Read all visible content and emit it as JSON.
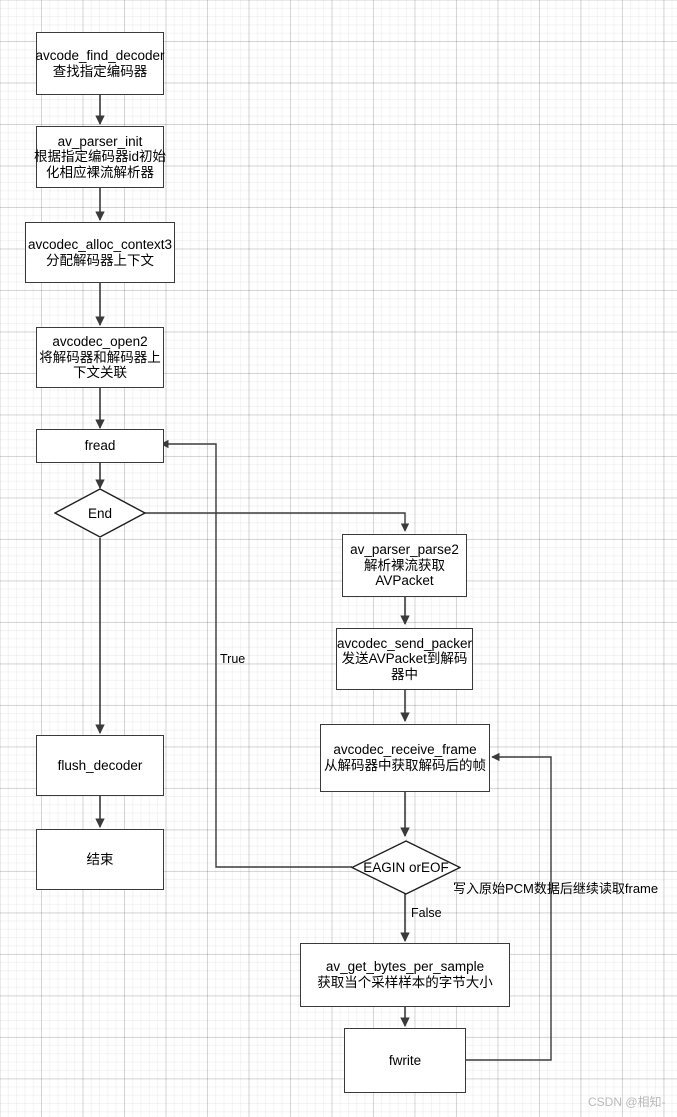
{
  "diagram": {
    "title": "FFmpeg audio decoding flowchart",
    "background": "#ffffff",
    "grid_color": "#e8e8e8",
    "node_border_color": "#3a3a3a",
    "edge_color": "#3a3a3a",
    "nodes": [
      {
        "id": "avcode_find_decoder",
        "shape": "process",
        "line1": "avcode_find_decoder",
        "line2": "查找指定编码器"
      },
      {
        "id": "av_parser_init",
        "shape": "process",
        "line1": "av_parser_init",
        "line2": "根据指定编码器id初始",
        "line3": "化相应裸流解析器"
      },
      {
        "id": "avcodec_alloc_context3",
        "shape": "process",
        "line1": "avcodec_alloc_context3",
        "line2": "分配解码器上下文"
      },
      {
        "id": "avcodec_open2",
        "shape": "process",
        "line1": "avcodec_open2",
        "line2": "将解码器和解码器上",
        "line3": "下文关联"
      },
      {
        "id": "fread",
        "shape": "process",
        "line1": "fread"
      },
      {
        "id": "end_decision",
        "shape": "decision",
        "line1": "End"
      },
      {
        "id": "flush_decoder",
        "shape": "process",
        "line1": "flush_decoder"
      },
      {
        "id": "finish",
        "shape": "process",
        "line1": "结束"
      },
      {
        "id": "av_parser_parse2",
        "shape": "process",
        "line1": "av_parser_parse2",
        "line2": "解析裸流获取",
        "line3": "AVPacket"
      },
      {
        "id": "avcodec_send_packer",
        "shape": "process",
        "line1": "avcodec_send_packer",
        "line2": "发送AVPacket到解码",
        "line3": "器中"
      },
      {
        "id": "avcodec_receive_frame",
        "shape": "process",
        "line1": "avcodec_receive_frame",
        "line2": "从解码器中获取解码后的帧"
      },
      {
        "id": "eagin_or_eof",
        "shape": "decision",
        "line1": "EAGIN orEOF"
      },
      {
        "id": "av_get_bytes_per_sample",
        "shape": "process",
        "line1": "av_get_bytes_per_sample",
        "line2": "获取当个采样样本的字节大小"
      },
      {
        "id": "fwrite",
        "shape": "process",
        "line1": "fwrite"
      }
    ],
    "edge_labels": [
      {
        "id": "true-label",
        "text": "True"
      },
      {
        "id": "false-label",
        "text": "False"
      }
    ],
    "annotations": [
      {
        "id": "pcm-note",
        "text": "写入原始PCM数据后继续读取frame"
      }
    ],
    "watermark": {
      "text": "CSDN @相知-"
    }
  }
}
